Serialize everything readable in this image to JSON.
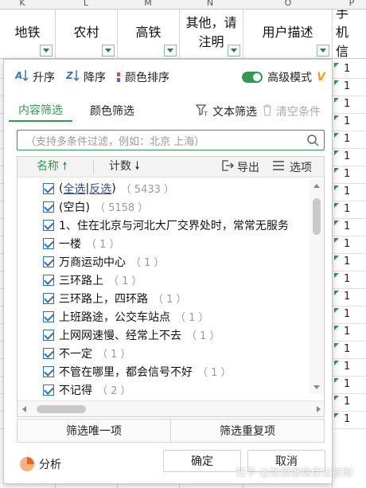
{
  "sheet": {
    "column_letters": [
      "K",
      "L",
      "M",
      "N",
      "O",
      "P"
    ],
    "headers": [
      "地铁",
      "农村",
      "高铁",
      "其他，请注明",
      "用户描述",
      "手机信"
    ],
    "right_values": [
      "1",
      "1",
      "1",
      "1",
      "1",
      "1",
      "1",
      "1",
      "1",
      "1",
      "1",
      "1",
      "1",
      "1",
      "1",
      "1",
      "1",
      "1",
      "1",
      "1",
      "1"
    ]
  },
  "toolbar": {
    "sort_asc": "升序",
    "sort_desc": "降序",
    "color_sort": "颜色排序",
    "advanced_mode": "高级模式",
    "advanced_badge": "V"
  },
  "tabs": {
    "content_filter": "内容筛选",
    "color_filter": "颜色筛选",
    "text_filter": "文本筛选",
    "clear_conditions": "清空条件"
  },
  "search": {
    "placeholder": "（支持多条件过滤，例如：北京 上海）"
  },
  "list_header": {
    "name": "名称",
    "count": "计数",
    "export": "导出",
    "options": "选项"
  },
  "items": [
    {
      "label_select_all": "全选",
      "label_invert": "反选",
      "count": "（ 5433 ）"
    },
    {
      "label": "(空白)",
      "count": "（ 5158 ）"
    },
    {
      "label": "1、住在北京与河北大厂交界处时，常常无服务",
      "count": ""
    },
    {
      "label": "一楼",
      "count": "（ 1 ）"
    },
    {
      "label": "万商运动中心",
      "count": "（ 1 ）"
    },
    {
      "label": "三环路上",
      "count": "（ 1 ）"
    },
    {
      "label": "三环路上，四环路",
      "count": "（ 1 ）"
    },
    {
      "label": "上班路途，公交车站点",
      "count": "（ 1 ）"
    },
    {
      "label": "上网网速慢、经常上不去",
      "count": "（ 1 ）"
    },
    {
      "label": "不一定",
      "count": "（ 1 ）"
    },
    {
      "label": "不管在哪里，都会信号不好",
      "count": "（ 1 ）"
    },
    {
      "label": "不记得",
      "count": "（ 2 ）"
    }
  ],
  "buttons": {
    "filter_unique": "筛选唯一项",
    "filter_duplicate": "筛选重复项",
    "analyze": "分析",
    "ok": "确定",
    "cancel": "取消"
  },
  "watermark": "知乎 @数模维嗨保证被剐",
  "colors": {
    "accent": "#2e9b50",
    "link": "#2f4fa0",
    "checkbox": "#2f6fbf"
  }
}
